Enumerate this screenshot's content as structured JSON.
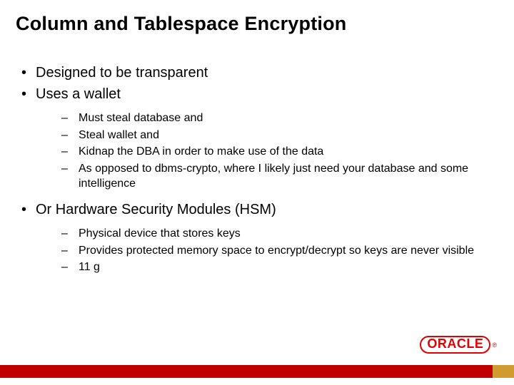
{
  "title": "Column and Tablespace Encryption",
  "bullets": [
    {
      "text": "Designed to be transparent",
      "sub": []
    },
    {
      "text": "Uses a wallet",
      "sub": [
        "Must steal database and",
        "Steal wallet and",
        "Kidnap the DBA in order to make use of the data",
        "As opposed to dbms-crypto, where I likely just need your database and some intelligence"
      ]
    },
    {
      "text": "Or Hardware Security Modules (HSM)",
      "sub": [
        "Physical device that stores keys",
        "Provides protected memory space to encrypt/decrypt so keys are never visible",
        "11 g"
      ]
    }
  ],
  "logo_text": "ORACLE",
  "logo_reg": "®",
  "colors": {
    "red_bar": "#c00000",
    "gold_bar": "#d19c2f",
    "oracle_red": "#e40000"
  }
}
